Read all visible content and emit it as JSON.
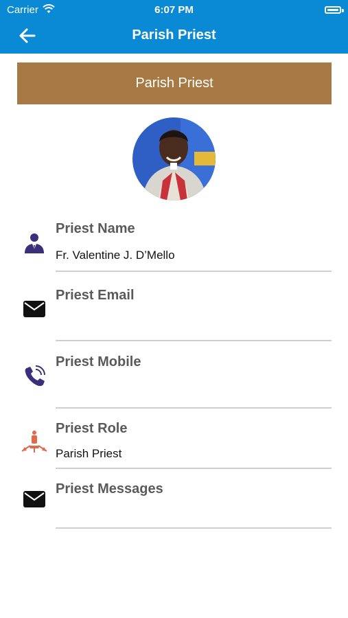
{
  "status_bar": {
    "carrier": "Carrier",
    "time": "6:07 PM"
  },
  "nav": {
    "title": "Parish Priest",
    "back_icon": "arrow-left-icon"
  },
  "banner": {
    "title": "Parish Priest"
  },
  "colors": {
    "header": "#0a8ad4",
    "banner": "#a77a45",
    "divider": "#cfcfcf"
  },
  "fields": [
    {
      "label": "Priest Name",
      "value": "Fr. Valentine J. D’Mello",
      "icon": "person-icon"
    },
    {
      "label": "Priest Email",
      "value": "",
      "icon": "envelope-icon"
    },
    {
      "label": "Priest Mobile",
      "value": "",
      "icon": "phone-icon"
    },
    {
      "label": "Priest Role",
      "value": "Parish Priest",
      "icon": "role-icon"
    },
    {
      "label": "Priest Messages",
      "value": "",
      "icon": "envelope-icon"
    }
  ]
}
